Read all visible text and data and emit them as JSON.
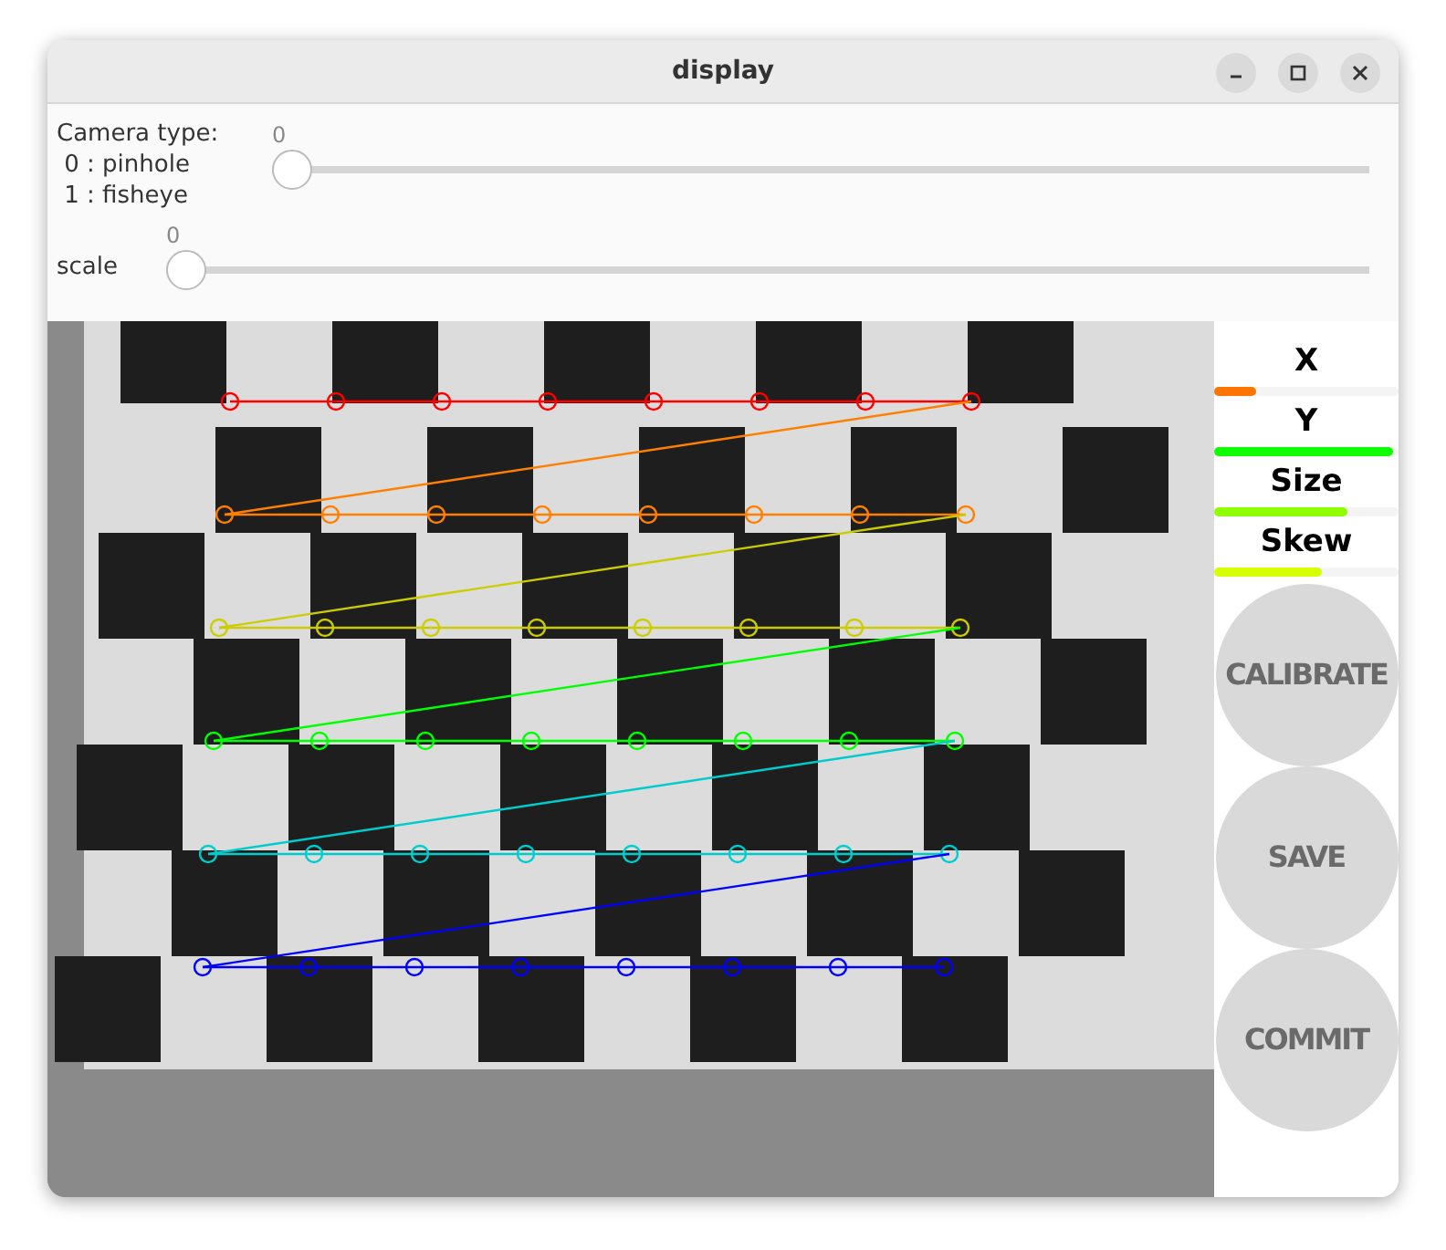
{
  "window": {
    "title": "display"
  },
  "trackbars": [
    {
      "label": "Camera type:\n 0 : pinhole\n 1 : fisheye",
      "reading": "0",
      "level": 0
    },
    {
      "label": "scale",
      "reading": "0",
      "level": 0
    }
  ],
  "progress": [
    {
      "label": "X",
      "level": 0.23
    },
    {
      "label": "Y",
      "level": 0.97
    },
    {
      "label": "Size",
      "level": 0.72
    },
    {
      "label": "Skew",
      "level": 0.58
    }
  ],
  "buttons": [
    {
      "label": "CALIBRATE",
      "disabled": true
    },
    {
      "label": "SAVE",
      "disabled": true
    },
    {
      "label": "COMMIT",
      "disabled": true
    }
  ]
}
